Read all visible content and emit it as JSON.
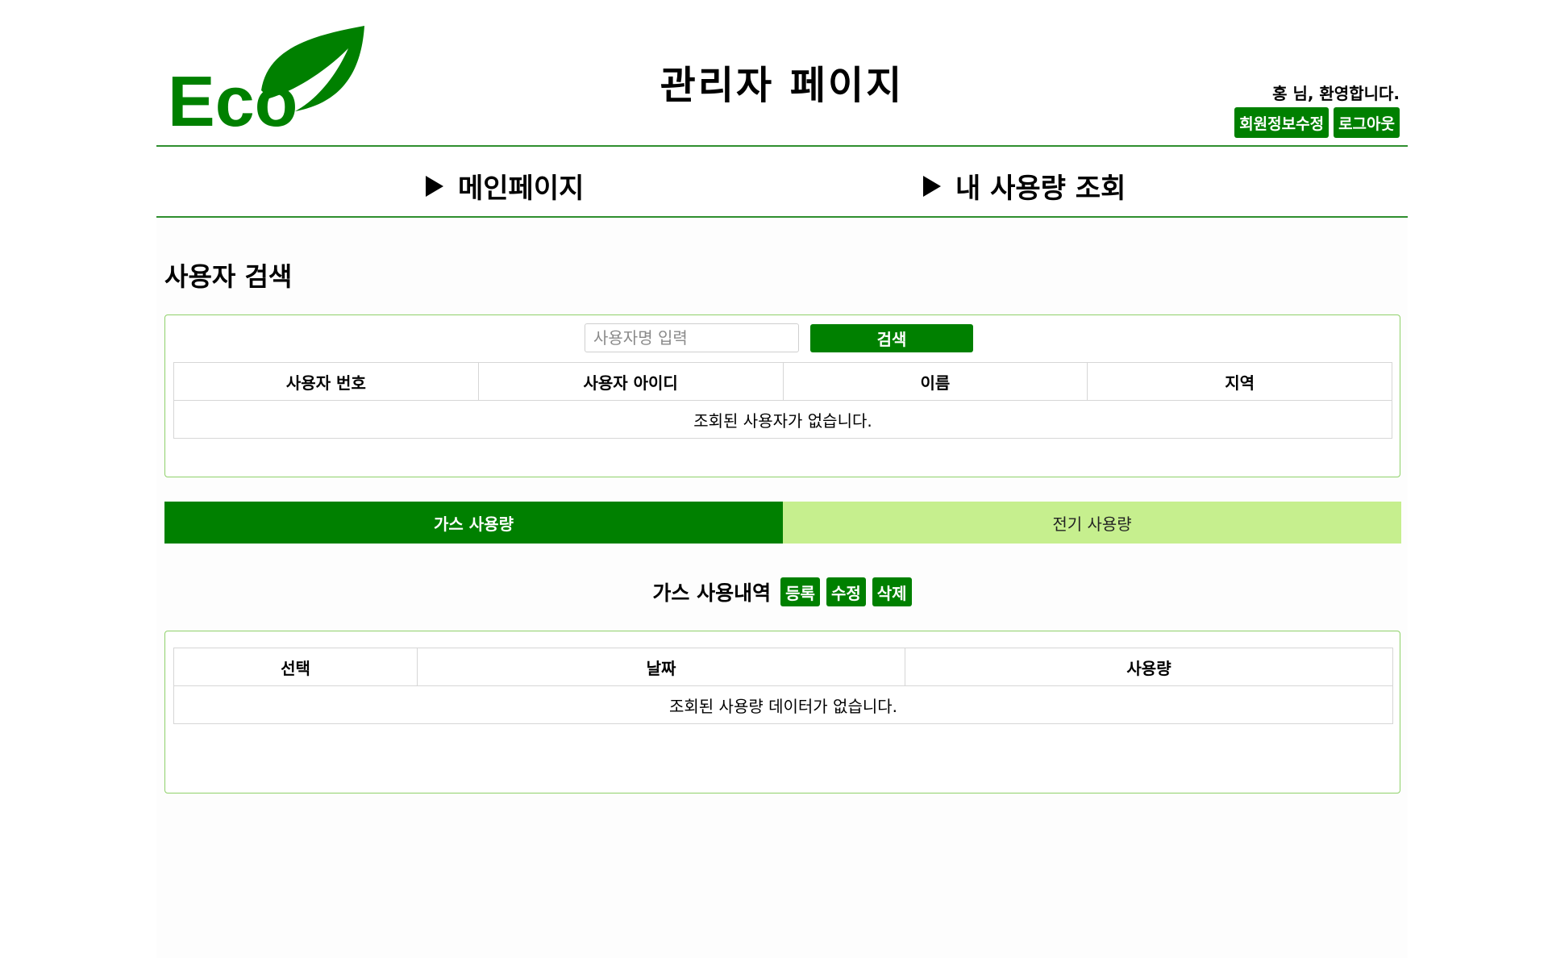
{
  "header": {
    "logo_text": "Eco",
    "title": "관리자 페이지",
    "welcome": "홍 님, 환영합니다.",
    "edit_profile_label": "회원정보수정",
    "logout_label": "로그아웃"
  },
  "nav": {
    "items": [
      {
        "label": "메인페이지"
      },
      {
        "label": "내 사용량 조회"
      }
    ]
  },
  "user_search": {
    "title": "사용자 검색",
    "placeholder": "사용자명 입력",
    "value": "",
    "search_label": "검색",
    "columns": [
      "사용자 번호",
      "사용자 아이디",
      "이름",
      "지역"
    ],
    "empty_message": "조회된 사용자가 없습니다."
  },
  "tabs": [
    {
      "label": "가스 사용량",
      "active": true
    },
    {
      "label": "전기 사용량",
      "active": false
    }
  ],
  "usage": {
    "title": "가스 사용내역",
    "register_label": "등록",
    "edit_label": "수정",
    "delete_label": "삭제",
    "columns": [
      "선택",
      "날짜",
      "사용량"
    ],
    "empty_message": "조회된 사용량 데이터가 없습니다."
  },
  "colors": {
    "primary": "#008000",
    "border": "#2f8f2f",
    "panel_border": "#8fd16a",
    "tab_inactive": "#c6ef8e"
  }
}
